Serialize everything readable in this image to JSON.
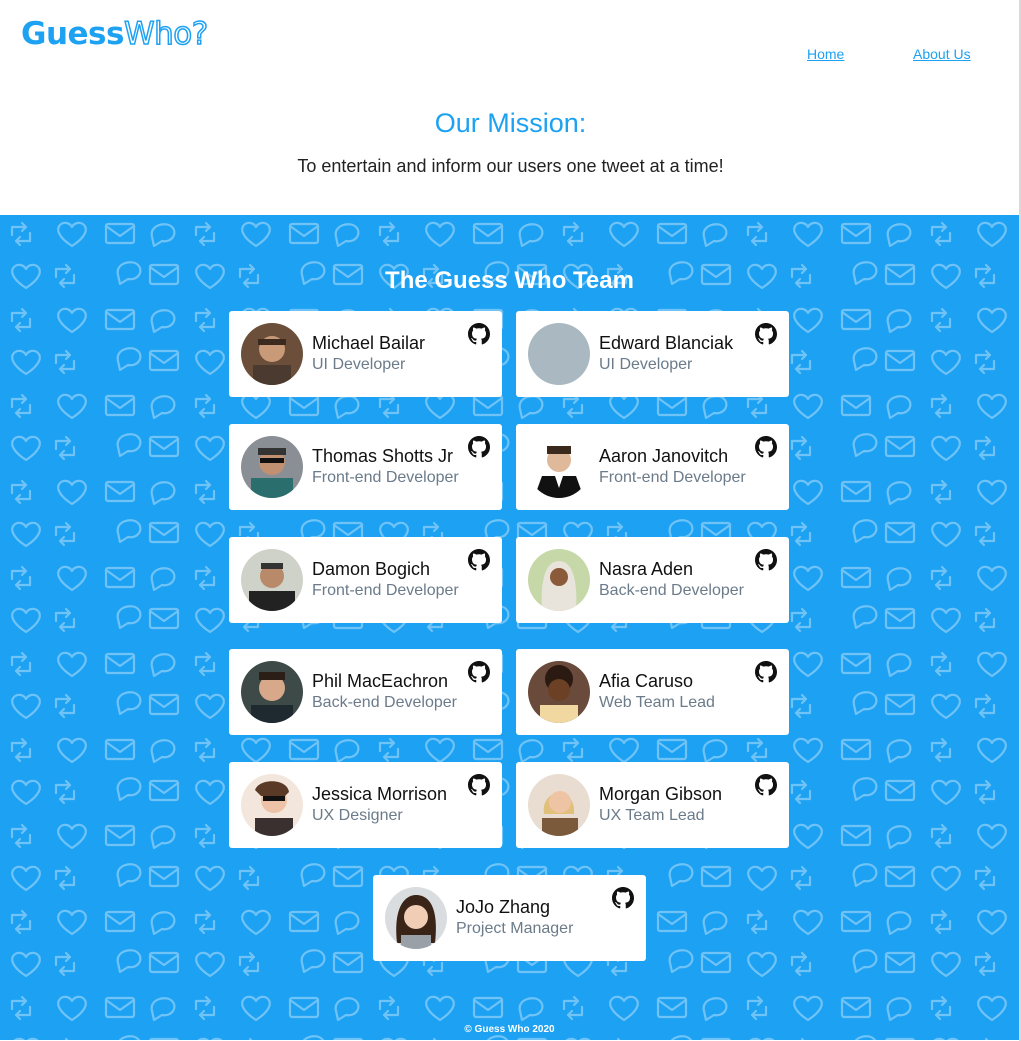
{
  "header": {
    "logo_part1": "Guess",
    "logo_part2": "Who?",
    "nav": [
      {
        "label": "Home"
      },
      {
        "label": "About Us"
      }
    ]
  },
  "mission": {
    "title": "Our Mission:",
    "text": "To entertain and inform our users one tweet at a time!"
  },
  "team": {
    "title": "The Guess Who Team",
    "members": [
      {
        "name": "Michael Bailar",
        "role": "UI Developer",
        "icon": "github-icon"
      },
      {
        "name": "Edward Blanciak",
        "role": "UI Developer",
        "icon": "github-icon"
      },
      {
        "name": "Thomas Shotts Jr",
        "role": "Front-end Developer",
        "icon": "github-icon"
      },
      {
        "name": "Aaron Janovitch",
        "role": "Front-end Developer",
        "icon": "github-icon"
      },
      {
        "name": "Damon Bogich",
        "role": "Front-end Developer",
        "icon": "github-icon"
      },
      {
        "name": "Nasra Aden",
        "role": "Back-end Developer",
        "icon": "github-icon"
      },
      {
        "name": "Phil MacEachron",
        "role": "Back-end Developer",
        "icon": "github-icon"
      },
      {
        "name": "Afia Caruso",
        "role": "Web Team Lead",
        "icon": "github-icon"
      },
      {
        "name": "Jessica Morrison",
        "role": "UX Designer",
        "icon": "github-icon"
      },
      {
        "name": "Morgan Gibson",
        "role": "UX Team Lead",
        "icon": "github-icon"
      },
      {
        "name": "JoJo Zhang",
        "role": "Project Manager",
        "icon": "github-icon"
      }
    ]
  },
  "footer": {
    "text": "© Guess Who 2020"
  },
  "colors": {
    "accent": "#1DA1F2",
    "text": "#222222",
    "role_text": "#6b7b8a"
  }
}
